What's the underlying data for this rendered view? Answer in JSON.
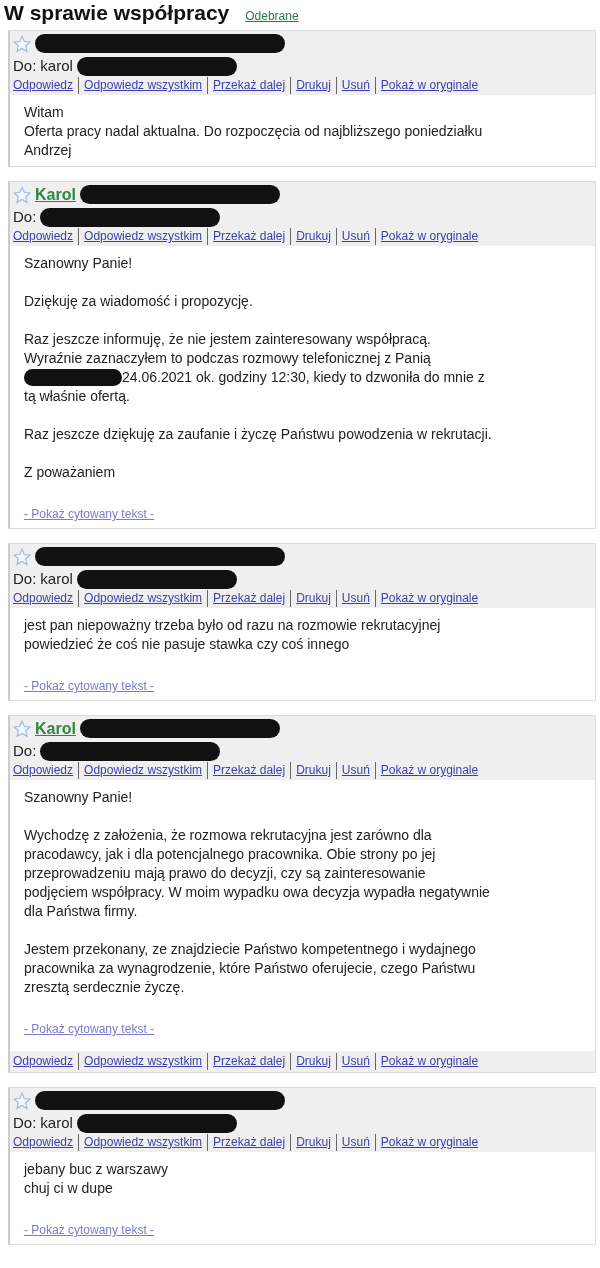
{
  "title": "W sprawie współpracy",
  "label": "Odebrane",
  "messages": [
    {
      "to_label": "Do:",
      "to": "karol",
      "actions": [
        "Odpowiedz",
        "Odpowiedz wszystkim",
        "Przekaż dalej",
        "Drukuj",
        "Usuń",
        "Pokaż w oryginale"
      ],
      "paragraphs": [
        [
          {
            "kind": "text",
            "text": "Witam"
          },
          {
            "kind": "text",
            "text": "Oferta pracy nadal aktualna. Do rozpoczęcia od najbliższego poniedziałku"
          },
          {
            "kind": "text",
            "text": "Andrzej"
          }
        ]
      ]
    },
    {
      "sender_name": "Karol",
      "to_label": "Do:",
      "actions": [
        "Odpowiedz",
        "Odpowiedz wszystkim",
        "Przekaż dalej",
        "Drukuj",
        "Usuń",
        "Pokaż w oryginale"
      ],
      "paragraphs": [
        [
          {
            "kind": "text",
            "text": "Szanowny Panie!"
          }
        ],
        [
          {
            "kind": "text",
            "text": "Dziękuję za wiadomość i propozycję."
          }
        ],
        [
          {
            "kind": "text",
            "text": "Raz jeszcze informuję, że nie jestem zainteresowany współpracą."
          },
          {
            "kind": "text",
            "text": "Wyraźnie zaznaczyłem to podczas rozmowy telefonicznej z Panią"
          },
          {
            "kind": "after_redaction",
            "text": "24.06.2021 ok. godziny 12:30, kiedy to dzwoniła do mnie z"
          },
          {
            "kind": "text",
            "text": "tą właśnie ofertą."
          }
        ],
        [
          {
            "kind": "text",
            "text": "Raz jeszcze dziękuję za zaufanie i życzę Państwu powodzenia w rekrutacji."
          }
        ],
        [
          {
            "kind": "text",
            "text": "Z poważaniem"
          }
        ]
      ],
      "quoted_link": "- Pokaż cytowany tekst -"
    },
    {
      "to_label": "Do:",
      "to": "karol",
      "actions": [
        "Odpowiedz",
        "Odpowiedz wszystkim",
        "Przekaż dalej",
        "Drukuj",
        "Usuń",
        "Pokaż w oryginale"
      ],
      "paragraphs": [
        [
          {
            "kind": "text",
            "text": "jest pan niepoważny trzeba było od razu na rozmowie rekrutacyjnej"
          },
          {
            "kind": "text",
            "text": "powiedzieć że coś nie pasuje stawka czy coś innego"
          }
        ]
      ],
      "quoted_link": "- Pokaż cytowany tekst -"
    },
    {
      "sender_name": "Karol",
      "to_label": "Do:",
      "actions": [
        "Odpowiedz",
        "Odpowiedz wszystkim",
        "Przekaż dalej",
        "Drukuj",
        "Usuń",
        "Pokaż w oryginale"
      ],
      "paragraphs": [
        [
          {
            "kind": "text",
            "text": "Szanowny Panie!"
          }
        ],
        [
          {
            "kind": "text",
            "text": "Wychodzę z założenia, że rozmowa rekrutacyjna jest zarówno dla"
          },
          {
            "kind": "text",
            "text": "pracodawcy, jak i dla potencjalnego pracownika. Obie strony po jej"
          },
          {
            "kind": "text",
            "text": "przeprowadzeniu mają prawo do decyzji, czy są zainteresowanie"
          },
          {
            "kind": "text",
            "text": "podjęciem współpracy. W moim wypadku owa decyzja wypadła negatywnie"
          },
          {
            "kind": "text",
            "text": "dla Państwa firmy."
          }
        ],
        [
          {
            "kind": "text",
            "text": "Jestem przekonany, ze znajdziecie Państwo kompetentnego i wydajnego"
          },
          {
            "kind": "text",
            "text": "pracownika za wynagrodzenie, które Państwo oferujecie, czego Państwu"
          },
          {
            "kind": "text",
            "text": "zresztą serdecznie życzę."
          }
        ]
      ],
      "quoted_link": "- Pokaż cytowany tekst -",
      "footer_actions": [
        "Odpowiedz",
        "Odpowiedz wszystkim",
        "Przekaż dalej",
        "Drukuj",
        "Usuń",
        "Pokaż w oryginale"
      ]
    },
    {
      "to_label": "Do:",
      "to": "karol",
      "actions": [
        "Odpowiedz",
        "Odpowiedz wszystkim",
        "Przekaż dalej",
        "Drukuj",
        "Usuń",
        "Pokaż w oryginale"
      ],
      "paragraphs": [
        [
          {
            "kind": "text",
            "text": "jebany buc z warszawy"
          },
          {
            "kind": "text",
            "text": "chuj ci w dupe"
          }
        ]
      ],
      "quoted_link": "- Pokaż cytowany tekst -"
    }
  ]
}
